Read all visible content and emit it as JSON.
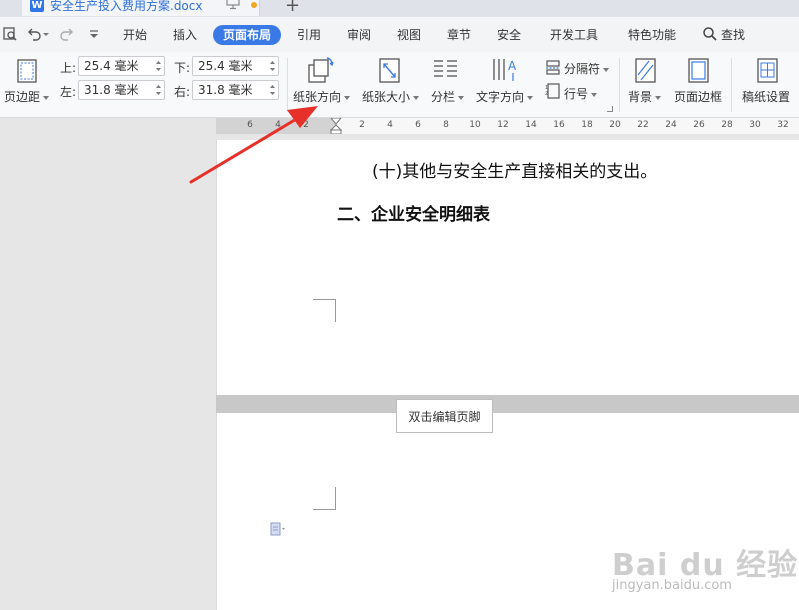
{
  "title_bar": {
    "doc_icon": "W",
    "doc_name": "安全生产投入费用方案.docx"
  },
  "menu": {
    "items": [
      "开始",
      "插入",
      "页面布局",
      "引用",
      "审阅",
      "视图",
      "章节",
      "安全",
      "开发工具",
      "特色功能"
    ],
    "active": "页面布局",
    "search": "查找"
  },
  "ribbon": {
    "margin_button": "页边距",
    "margins": {
      "top_label": "上:",
      "top": "25.4 毫米",
      "bottom_label": "下:",
      "bottom": "25.4 毫米",
      "left_label": "左:",
      "left": "31.8 毫米",
      "right_label": "右:",
      "right": "31.8 毫米"
    },
    "orientation": "纸张方向",
    "size": "纸张大小",
    "columns": "分栏",
    "text_direction": "文字方向",
    "separator": "分隔符",
    "line_number": "行号",
    "background": "背景",
    "page_border": "页面边框",
    "grid_paper": "稿纸设置"
  },
  "ruler": {
    "left_ticks": [
      "6",
      "4",
      "2"
    ],
    "right_ticks": [
      "2",
      "4",
      "6",
      "8",
      "10",
      "12",
      "14",
      "16",
      "18",
      "20",
      "22",
      "24",
      "26",
      "28",
      "30",
      "32"
    ]
  },
  "document": {
    "line1": "(十)其他与安全生产直接相关的支出。",
    "heading": "二、企业安全明细表",
    "footer_tip": "双击编辑页脚"
  },
  "watermark": {
    "logo": "Bai du 经验",
    "url": "jingyan.baidu.com"
  },
  "colors": {
    "accent": "#3a7ae6",
    "arrow": "#e8302a",
    "unsaved_dot": "#f5a623"
  }
}
